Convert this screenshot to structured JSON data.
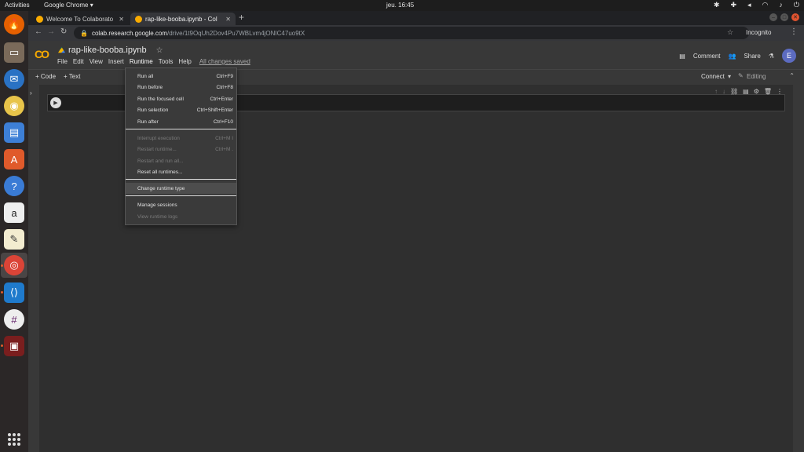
{
  "os": {
    "activities": "Activities",
    "app_menu": "Google Chrome ▾",
    "clock": "jeu. 16:45"
  },
  "browser": {
    "tabs": [
      {
        "title": "Welcome To Colaborato"
      },
      {
        "title": "rap-like-booba.ipynb - Col"
      }
    ],
    "url_host": "colab.research.google.com",
    "url_path": "/drive/1t9OqUh2Dov4Pu7WBLvm4jONIC47uo9tX",
    "incognito_label": "Incognito"
  },
  "colab": {
    "logo": "CO",
    "notebook_title": "rap-like-booba.ipynb",
    "menus": [
      "File",
      "Edit",
      "View",
      "Insert",
      "Runtime",
      "Tools",
      "Help"
    ],
    "save_status": "All changes saved",
    "comment_label": "Comment",
    "share_label": "Share",
    "avatar_letter": "E",
    "add_code": "+ Code",
    "add_text": "+ Text",
    "connect_label": "Connect",
    "editing_label": "Editing"
  },
  "runtime_menu": {
    "items": [
      {
        "label": "Run all",
        "shortcut": "Ctrl+F9",
        "enabled": true
      },
      {
        "label": "Run before",
        "shortcut": "Ctrl+F8",
        "enabled": true
      },
      {
        "label": "Run the focused cell",
        "shortcut": "Ctrl+Enter",
        "enabled": true
      },
      {
        "label": "Run selection",
        "shortcut": "Ctrl+Shift+Enter",
        "enabled": true
      },
      {
        "label": "Run after",
        "shortcut": "Ctrl+F10",
        "enabled": true
      },
      {
        "label": "Interrupt execution",
        "shortcut": "Ctrl+M I",
        "enabled": false
      },
      {
        "label": "Restart runtime...",
        "shortcut": "Ctrl+M .",
        "enabled": false
      },
      {
        "label": "Restart and run all...",
        "shortcut": "",
        "enabled": false
      },
      {
        "label": "Reset all runtimes...",
        "shortcut": "",
        "enabled": true
      },
      {
        "label": "Change runtime type",
        "shortcut": "",
        "enabled": true
      },
      {
        "label": "Manage sessions",
        "shortcut": "",
        "enabled": true
      },
      {
        "label": "View runtime logs",
        "shortcut": "",
        "enabled": false
      }
    ]
  }
}
